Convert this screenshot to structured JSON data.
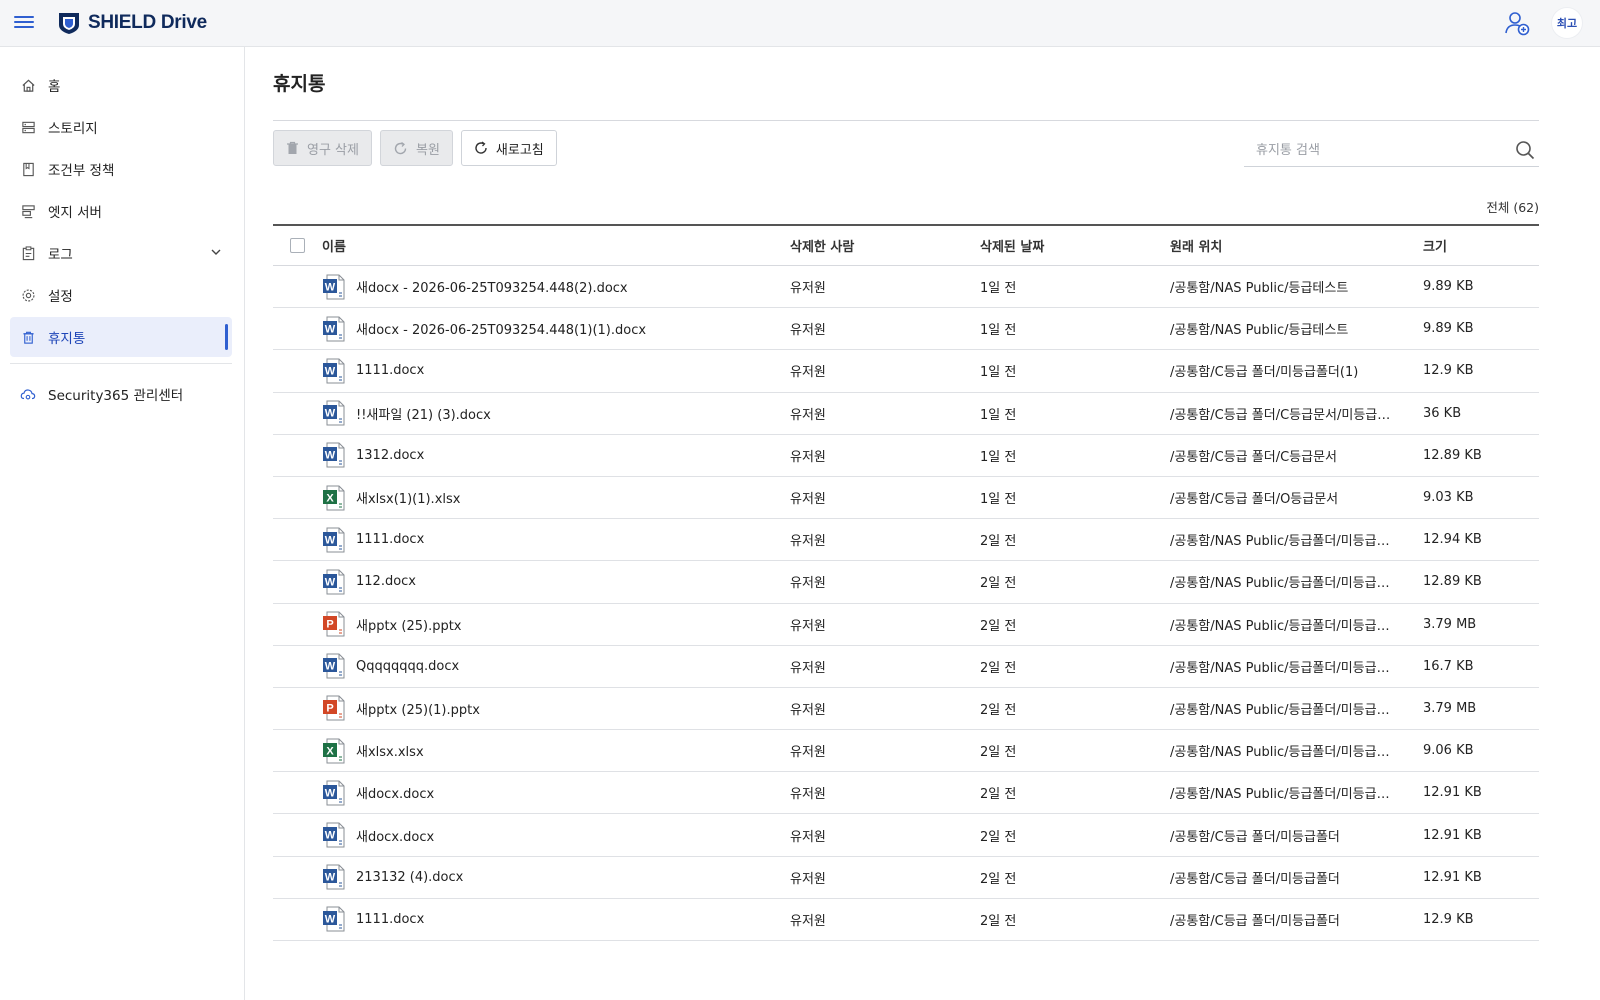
{
  "app": {
    "logo_text": "SHIELD Drive",
    "avatar_text": "최고"
  },
  "colors": {
    "accent": "#2f5fd0",
    "word": "#2b579a",
    "excel": "#1e7145",
    "powerpoint": "#d24726"
  },
  "sidebar": {
    "items": [
      {
        "label": "홈",
        "icon": "home-icon"
      },
      {
        "label": "스토리지",
        "icon": "storage-icon"
      },
      {
        "label": "조건부 정책",
        "icon": "policy-icon"
      },
      {
        "label": "엣지 서버",
        "icon": "server-icon"
      },
      {
        "label": "로그",
        "icon": "log-icon"
      },
      {
        "label": "설정",
        "icon": "gear-icon"
      },
      {
        "label": "휴지통",
        "icon": "trash-icon"
      }
    ],
    "footer_link": "Security365 관리센터"
  },
  "main": {
    "title": "휴지통",
    "toolbar": {
      "delete_label": "영구 삭제",
      "restore_label": "복원",
      "refresh_label": "새로고침"
    },
    "search": {
      "placeholder": "휴지통 검색"
    },
    "total_label": "전체 (62)",
    "table": {
      "columns": {
        "name": "이름",
        "deleted_by": "삭제한 사람",
        "deleted_date": "삭제된 날짜",
        "location": "원래 위치",
        "size": "크기"
      },
      "rows": [
        {
          "type": "word",
          "name": "새docx - 2026-06-25T093254.448(2).docx",
          "by": "유저원",
          "date": "1일 전",
          "location": "/공통함/NAS Public/등급테스트",
          "size": "9.89 KB"
        },
        {
          "type": "word",
          "name": "새docx - 2026-06-25T093254.448(1)(1).docx",
          "by": "유저원",
          "date": "1일 전",
          "location": "/공통함/NAS Public/등급테스트",
          "size": "9.89 KB"
        },
        {
          "type": "word",
          "name": "1111.docx",
          "by": "유저원",
          "date": "1일 전",
          "location": "/공통함/C등급 폴더/미등급폴더(1)",
          "size": "12.9 KB"
        },
        {
          "type": "word",
          "name": "!!새파일 (21) (3).docx",
          "by": "유저원",
          "date": "1일 전",
          "location": "/공통함/C등급 폴더/C등급문서/미등급…",
          "size": "36 KB"
        },
        {
          "type": "word",
          "name": "1312.docx",
          "by": "유저원",
          "date": "1일 전",
          "location": "/공통함/C등급 폴더/C등급문서",
          "size": "12.89 KB"
        },
        {
          "type": "excel",
          "name": "새xlsx(1)(1).xlsx",
          "by": "유저원",
          "date": "1일 전",
          "location": "/공통함/C등급 폴더/O등급문서",
          "size": "9.03 KB"
        },
        {
          "type": "word",
          "name": "1111.docx",
          "by": "유저원",
          "date": "2일 전",
          "location": "/공통함/NAS Public/등급폴더/미등급…",
          "size": "12.94 KB"
        },
        {
          "type": "word",
          "name": "112.docx",
          "by": "유저원",
          "date": "2일 전",
          "location": "/공통함/NAS Public/등급폴더/미등급…",
          "size": "12.89 KB"
        },
        {
          "type": "powerpoint",
          "name": "새pptx (25).pptx",
          "by": "유저원",
          "date": "2일 전",
          "location": "/공통함/NAS Public/등급폴더/미등급…",
          "size": "3.79 MB"
        },
        {
          "type": "word",
          "name": "Qqqqqqqq.docx",
          "by": "유저원",
          "date": "2일 전",
          "location": "/공통함/NAS Public/등급폴더/미등급…",
          "size": "16.7 KB"
        },
        {
          "type": "powerpoint",
          "name": "새pptx (25)(1).pptx",
          "by": "유저원",
          "date": "2일 전",
          "location": "/공통함/NAS Public/등급폴더/미등급…",
          "size": "3.79 MB"
        },
        {
          "type": "excel",
          "name": "새xlsx.xlsx",
          "by": "유저원",
          "date": "2일 전",
          "location": "/공통함/NAS Public/등급폴더/미등급…",
          "size": "9.06 KB"
        },
        {
          "type": "word",
          "name": "새docx.docx",
          "by": "유저원",
          "date": "2일 전",
          "location": "/공통함/NAS Public/등급폴더/미등급…",
          "size": "12.91 KB"
        },
        {
          "type": "word",
          "name": "새docx.docx",
          "by": "유저원",
          "date": "2일 전",
          "location": "/공통함/C등급 폴더/미등급폴더",
          "size": "12.91 KB"
        },
        {
          "type": "word",
          "name": "213132 (4).docx",
          "by": "유저원",
          "date": "2일 전",
          "location": "/공통함/C등급 폴더/미등급폴더",
          "size": "12.91 KB"
        },
        {
          "type": "word",
          "name": "1111.docx",
          "by": "유저원",
          "date": "2일 전",
          "location": "/공통함/C등급 폴더/미등급폴더",
          "size": "12.9 KB"
        }
      ]
    }
  }
}
